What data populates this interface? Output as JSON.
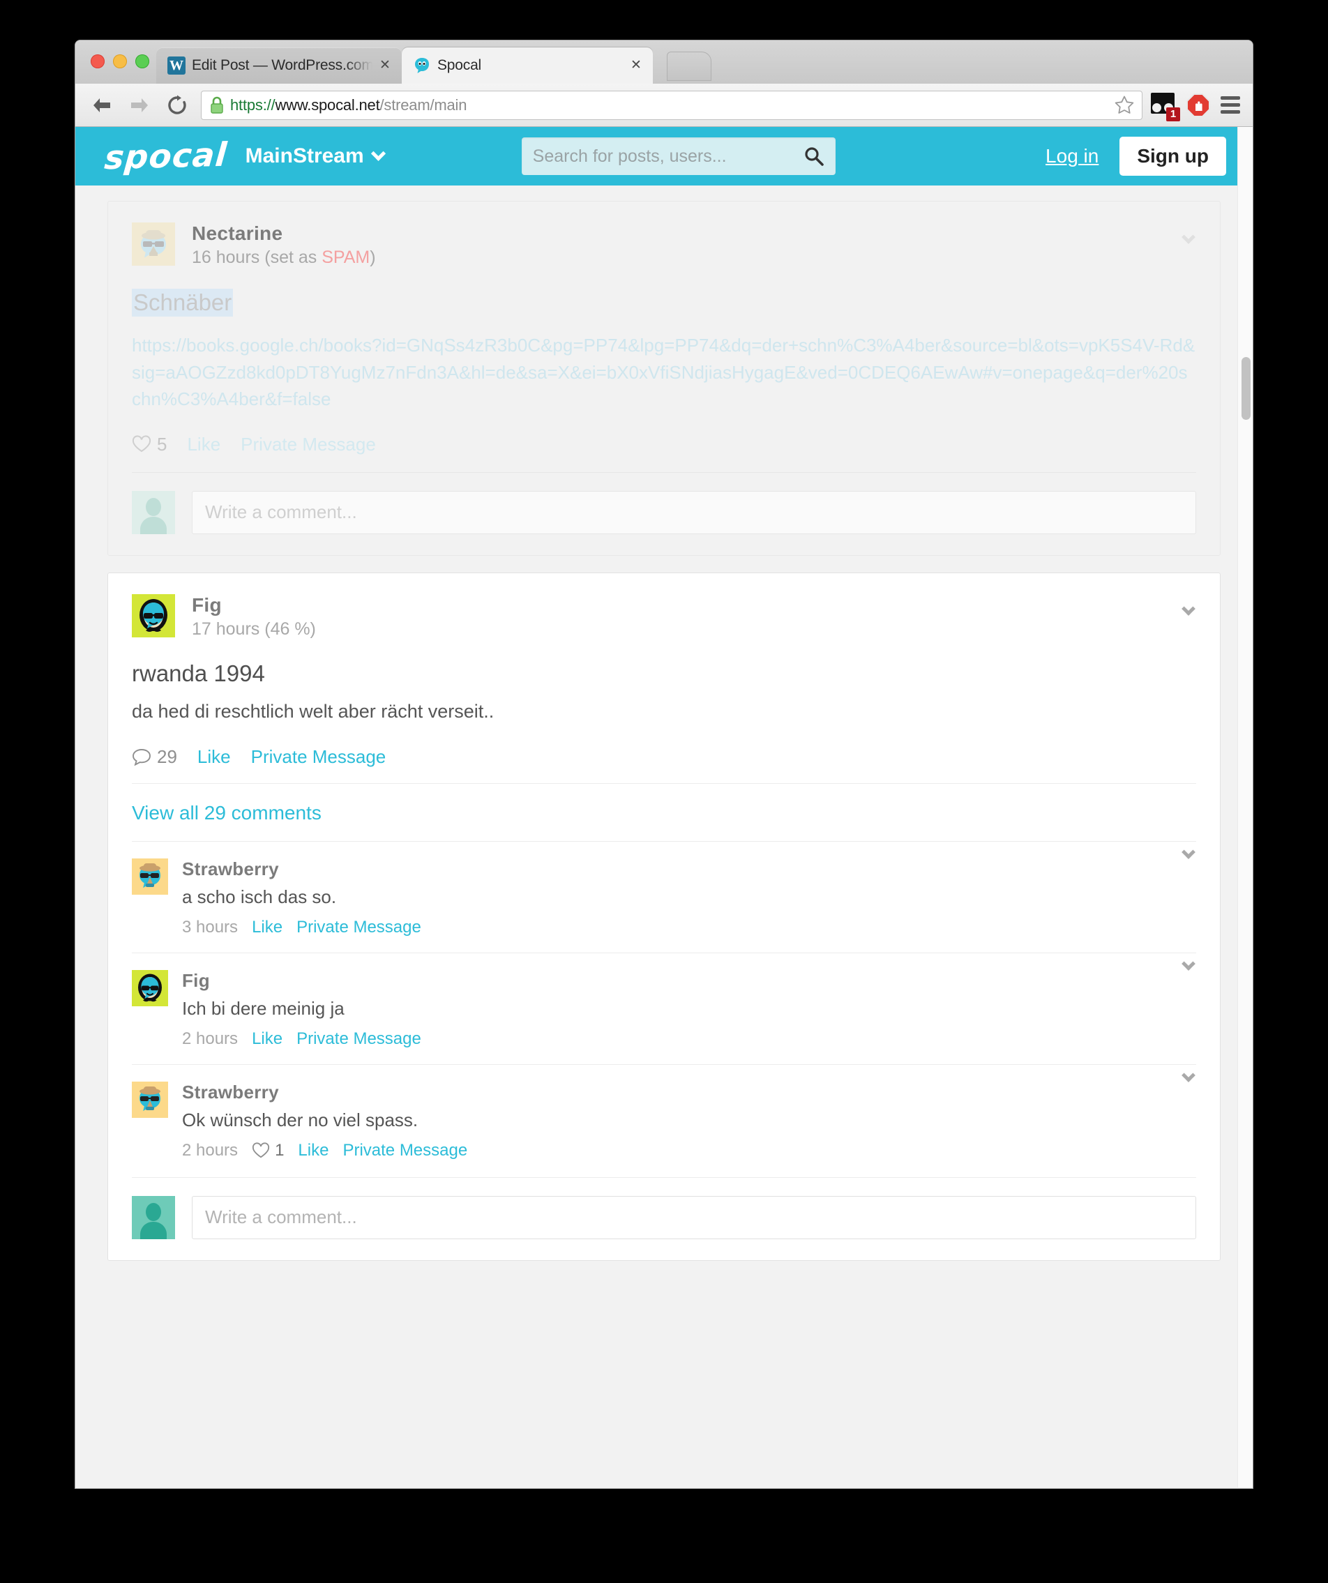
{
  "browser": {
    "tabs": [
      {
        "title": "Edit Post — WordPress.com",
        "favicon": "wordpress-icon",
        "active": false
      },
      {
        "title": "Spocal",
        "favicon": "spocal-icon",
        "active": true
      }
    ],
    "close_glyph": "✕",
    "url": {
      "scheme": "https://",
      "host": "www.spocal.net",
      "path": "/stream/main"
    },
    "extensions": [
      {
        "name": "extension-badge-icon",
        "badge": "1"
      },
      {
        "name": "adblock-icon",
        "badge": ""
      },
      {
        "name": "menu-icon",
        "badge": ""
      }
    ]
  },
  "site": {
    "logo": "spocal",
    "stream": "MainStream",
    "search_placeholder": "Search for posts, users...",
    "login_label": "Log in",
    "signup_label": "Sign up",
    "accent_color": "#2cbcd8"
  },
  "posts": [
    {
      "author": "Nectarine",
      "timestamp": "16 hours",
      "status_prefix": "(set as ",
      "status_flag": "SPAM",
      "status_suffix": ")",
      "title": "Schnäber",
      "link": "https://books.google.ch/books?id=GNqSs4zR3b0C&pg=PP74&lpg=PP74&dq=der+schn%C3%A4ber&source=bl&ots=vpK5S4V-Rd&sig=aAOGZzd8kd0pDT8YugMz7nFdn3A&hl=de&sa=X&ei=bX0xVfiSNdjiasHygagE&ved=0CDEQ6AEwAw#v=onepage&q=der%20schn%C3%A4ber&f=false",
      "like_count": "5",
      "like_label": "Like",
      "pm_label": "Private Message",
      "composer_placeholder": "Write a comment..."
    },
    {
      "author": "Fig",
      "timestamp": "17 hours",
      "percent": "(46 %)",
      "title": "rwanda 1994",
      "body": "da hed di reschtlich welt aber rächt verseit..",
      "comment_count": "29",
      "like_label": "Like",
      "pm_label": "Private Message",
      "view_all_label": "View all 29 comments",
      "composer_placeholder": "Write a comment...",
      "comments": [
        {
          "author": "Strawberry",
          "text": "a scho isch das so.",
          "timestamp": "3 hours",
          "likes": "",
          "like_label": "Like",
          "pm_label": "Private Message",
          "avatar": "strawberry-avatar"
        },
        {
          "author": "Fig",
          "text": "Ich bi dere meinig ja",
          "timestamp": "2 hours",
          "likes": "",
          "like_label": "Like",
          "pm_label": "Private Message",
          "avatar": "fig-avatar"
        },
        {
          "author": "Strawberry",
          "text": "Ok wünsch der no viel spass.",
          "timestamp": "2 hours",
          "likes": "1",
          "like_label": "Like",
          "pm_label": "Private Message",
          "avatar": "strawberry-avatar"
        }
      ]
    }
  ]
}
